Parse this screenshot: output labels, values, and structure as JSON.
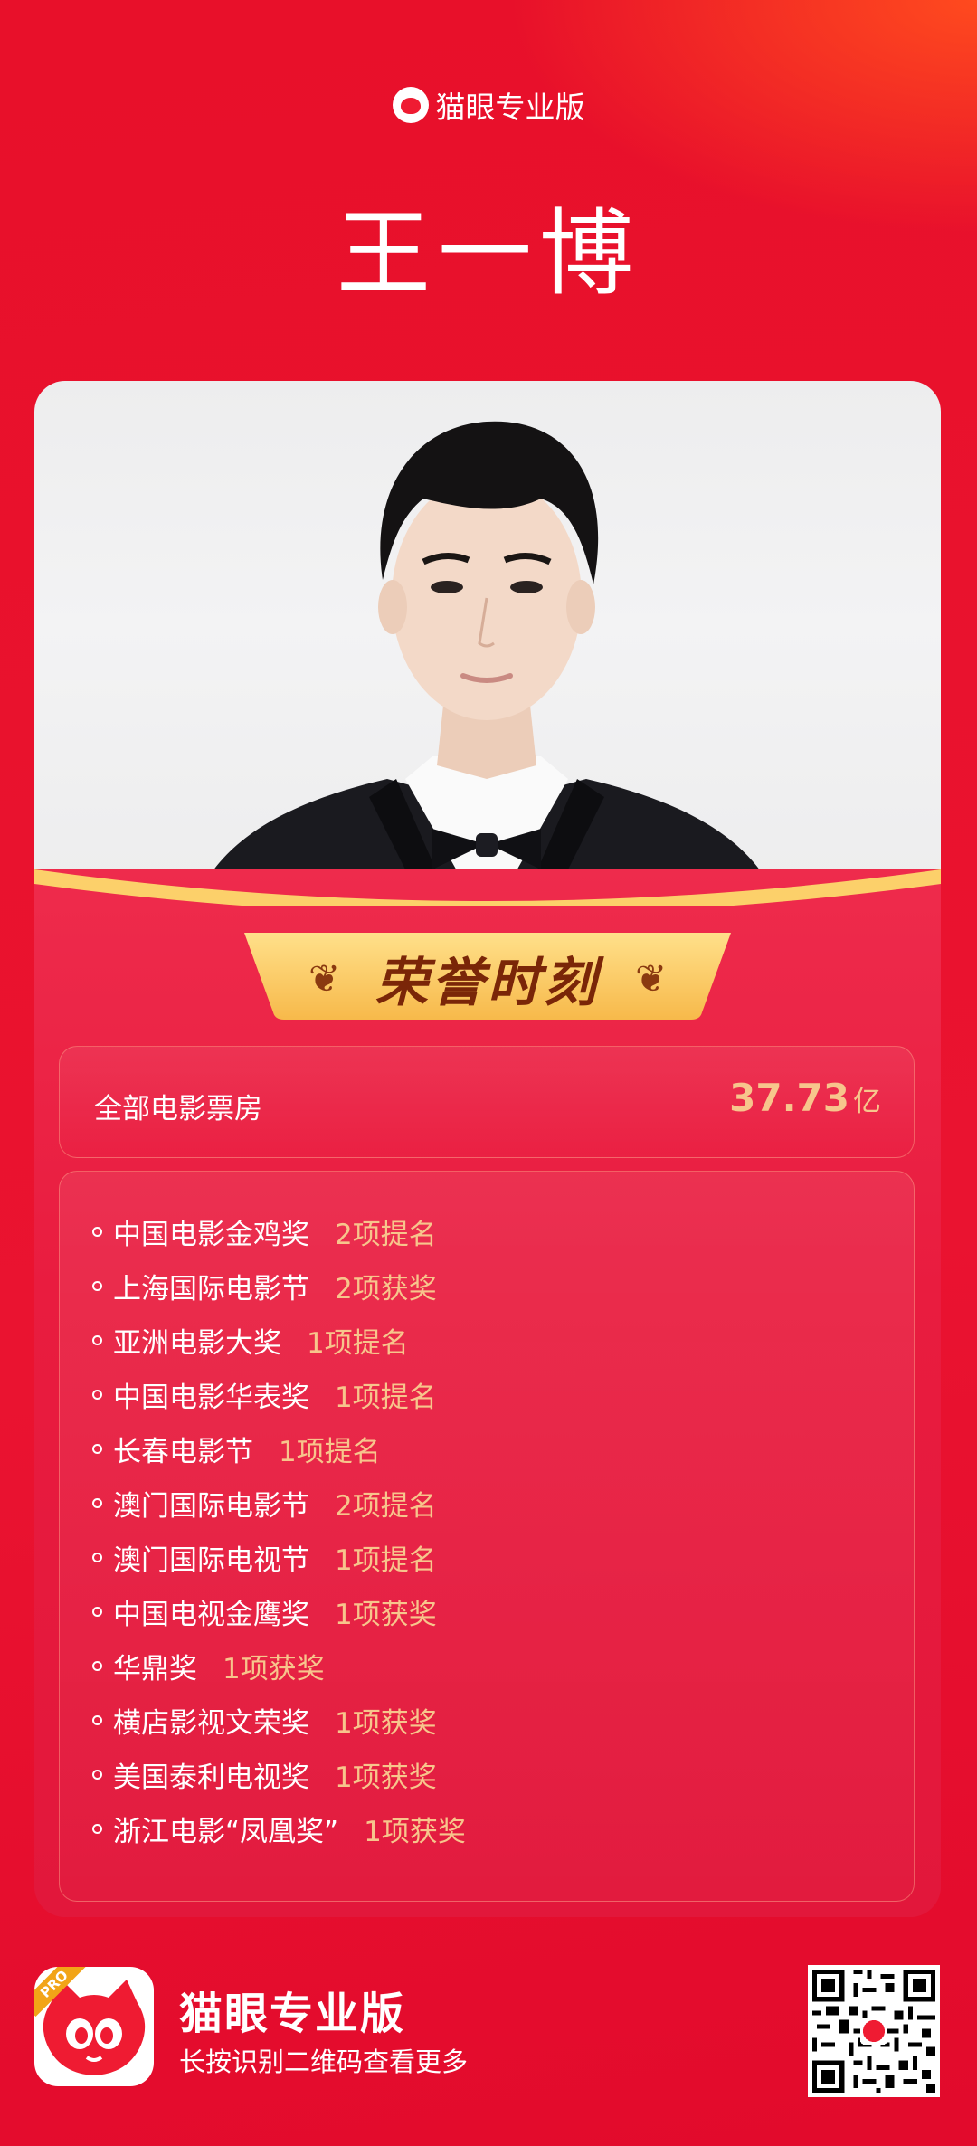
{
  "brand": {
    "name": "猫眼专业版"
  },
  "person": {
    "name": "王一博"
  },
  "card": {
    "honor_title": "荣誉时刻",
    "box_office": {
      "label": "全部电影票房",
      "value": "37.73",
      "unit": "亿"
    },
    "awards": [
      {
        "name": "中国电影金鸡奖",
        "result": "2项提名"
      },
      {
        "name": "上海国际电影节",
        "result": "2项获奖"
      },
      {
        "name": "亚洲电影大奖",
        "result": "1项提名"
      },
      {
        "name": "中国电影华表奖",
        "result": "1项提名"
      },
      {
        "name": "长春电影节",
        "result": "1项提名"
      },
      {
        "name": "澳门国际电影节",
        "result": "2项提名"
      },
      {
        "name": "澳门国际电视节",
        "result": "1项提名"
      },
      {
        "name": "中国电视金鹰奖",
        "result": "1项获奖"
      },
      {
        "name": "华鼎奖",
        "result": "1项获奖"
      },
      {
        "name": "横店影视文荣奖",
        "result": "1项获奖"
      },
      {
        "name": "美国泰利电视奖",
        "result": "1项获奖"
      },
      {
        "name": "浙江电影“凤凰奖”",
        "result": "1项获奖"
      }
    ]
  },
  "footer": {
    "app_name": "猫眼专业版",
    "badge": "PRO",
    "hint": "长按识别二维码查看更多"
  },
  "colors": {
    "primary_red": "#e8102a",
    "gold": "#f7c58c",
    "banner_gold": "#fcd06a"
  },
  "icons": {
    "brand_logo": "cat-face-icon",
    "qr": "qr-code-icon"
  }
}
